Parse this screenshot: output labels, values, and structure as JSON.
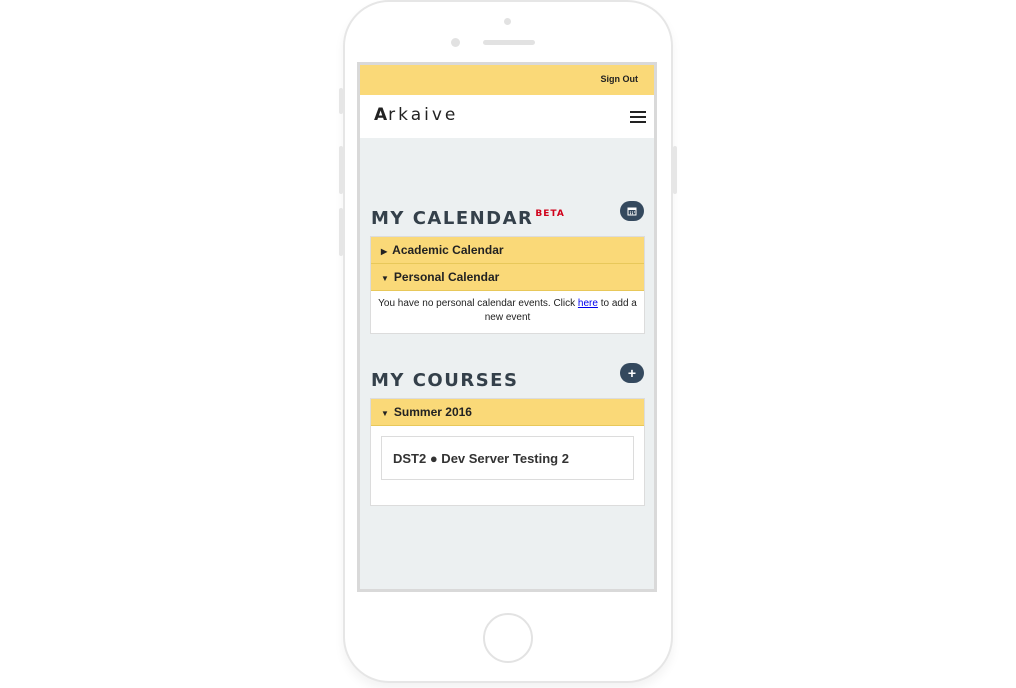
{
  "header": {
    "sign_out": "Sign Out"
  },
  "brand": {
    "logo_initial": "A",
    "logo_rest": "rkaive"
  },
  "calendar": {
    "title": "MY CALENDAR",
    "badge": "BETA",
    "icon": "calendar-icon",
    "academic_label": "Academic Calendar",
    "personal_label": "Personal Calendar",
    "empty_prefix": "You have no personal calendar events. Click ",
    "empty_link": "here",
    "empty_suffix": " to add a new event"
  },
  "courses": {
    "title": "MY COURSES",
    "add_icon": "plus-icon",
    "term_label": "Summer 2016",
    "items": [
      {
        "label": "DST2 ● Dev Server Testing 2"
      }
    ]
  },
  "colors": {
    "accent_yellow": "#fad978",
    "dark_button": "#34495e",
    "beta_red": "#d0021b"
  }
}
